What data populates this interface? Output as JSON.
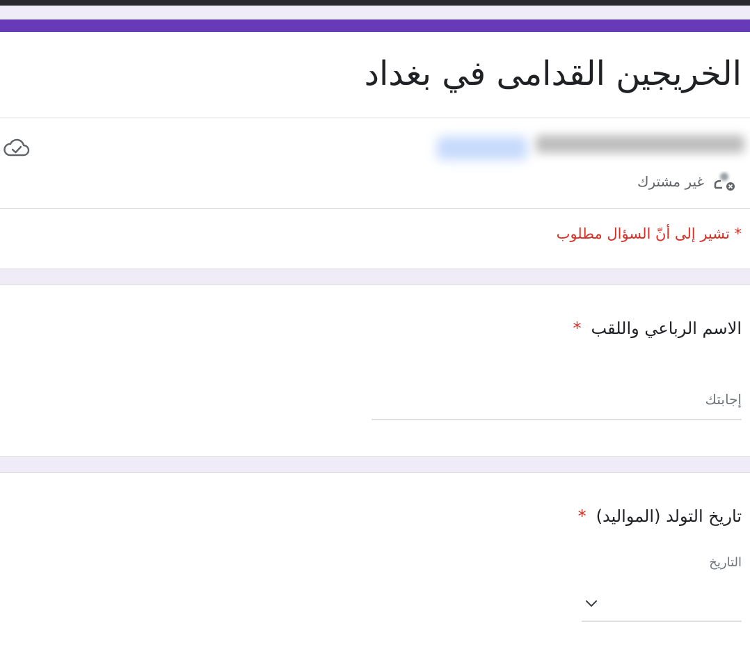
{
  "form": {
    "title": "الخريجين القدامى في بغداد",
    "accent_color": "#673ab7",
    "background_color": "#efebf7"
  },
  "account": {
    "status_icon": "cloud-check-icon",
    "not_shared_label": "غير مشترك",
    "not_shared_icon": "person-off-icon"
  },
  "required_note": "* تشير إلى أنّ السؤال مطلوب",
  "questions": [
    {
      "title": "الاسم الرباعي واللقب",
      "required_mark": "*",
      "placeholder": "إجابتك"
    },
    {
      "title": "تاريخ التولد (المواليد)",
      "required_mark": "*",
      "field_label": "التاريخ",
      "dropdown_icon": "chevron-down-icon"
    }
  ]
}
